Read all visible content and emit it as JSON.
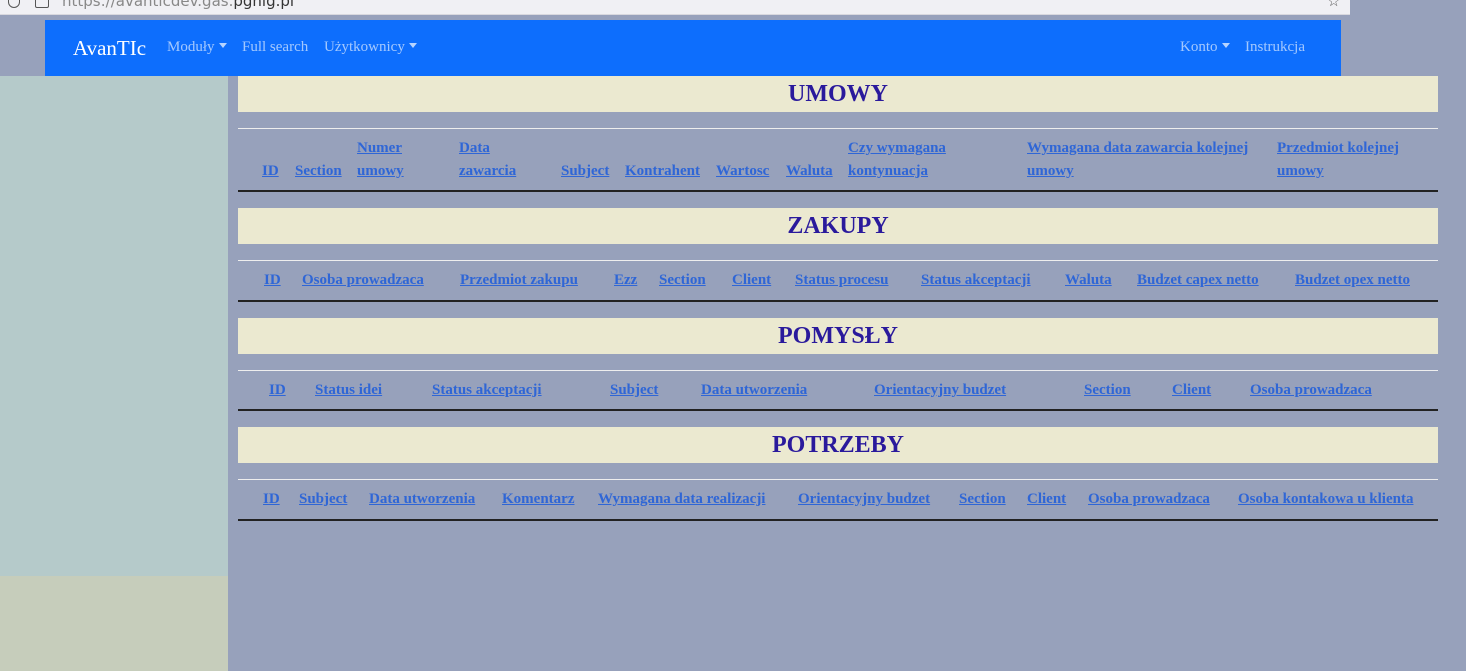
{
  "browser": {
    "url_prefix": "https://avanticdev.gas.",
    "url_domain": "pgnig.pl"
  },
  "navbar": {
    "brand": "AvanTIc",
    "items": [
      {
        "label": "Moduły",
        "dropdown": true
      },
      {
        "label": "Full search",
        "dropdown": false
      },
      {
        "label": "Użytkownicy",
        "dropdown": true
      }
    ],
    "right_items": [
      {
        "label": "Konto",
        "dropdown": true
      },
      {
        "label": "Instrukcja",
        "dropdown": false
      }
    ]
  },
  "sections": [
    {
      "title": "UMOWY",
      "columns": [
        "ID",
        "Section",
        "Numer umowy",
        "Data zawarcia",
        "Subject",
        "Kontrahent",
        "Wartosc",
        "Waluta",
        "Czy wymagana kontynuacja",
        "Wymagana data zawarcia kolejnej umowy",
        "Przedmiot kolejnej umowy"
      ]
    },
    {
      "title": "ZAKUPY",
      "columns": [
        "ID",
        "Osoba prowadzaca",
        "Przedmiot zakupu",
        "Ezz",
        "Section",
        "Client",
        "Status procesu",
        "Status akceptacji",
        "Waluta",
        "Budzet capex netto",
        "Budzet opex netto"
      ]
    },
    {
      "title": "POMYSŁY",
      "columns": [
        "ID",
        "Status idei",
        "Status akceptacji",
        "Subject",
        "Data utworzenia",
        "Orientacyjny budzet",
        "Section",
        "Client",
        "Osoba prowadzaca"
      ]
    },
    {
      "title": "POTRZEBY",
      "columns": [
        "ID",
        "Subject",
        "Data utworzenia",
        "Komentarz",
        "Wymagana data realizacji",
        "Orientacyjny budzet",
        "Section",
        "Client",
        "Osoba prowadzaca",
        "Osoba kontakowa u klienta"
      ]
    }
  ],
  "colors": {
    "navbar": "#0d6efd",
    "page_bg": "#97a1bb",
    "sidebar": "#b5caca",
    "section_title_bg": "#ebe9d0",
    "section_title_text": "#2a1a9c",
    "header_link": "#2f66d6"
  }
}
